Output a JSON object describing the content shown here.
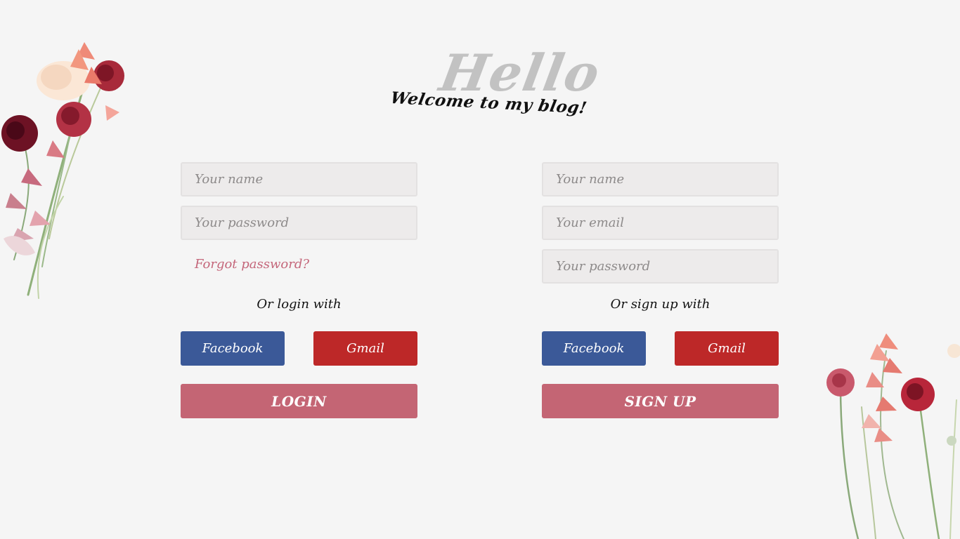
{
  "header": {
    "hello_text": "Hello",
    "welcome_text": "Welcome to my blog!"
  },
  "login_form": {
    "name_placeholder": "Your name",
    "password_placeholder": "Your password",
    "forgot_link": "Forgot password?",
    "or_text": "Or login with",
    "facebook_label": "Facebook",
    "gmail_label": "Gmail",
    "submit_label": "LOGIN"
  },
  "signup_form": {
    "name_placeholder": "Your name",
    "email_placeholder": "Your email",
    "password_placeholder": "Your password",
    "or_text": "Or sign up with",
    "facebook_label": "Facebook",
    "gmail_label": "Gmail",
    "submit_label": "SIGN UP"
  },
  "colors": {
    "background": "#f5f5f5",
    "facebook": "#3b5998",
    "gmail": "#bd2828",
    "primary": "#c46574",
    "link": "#c4667a",
    "input_bg": "#edebeb"
  }
}
